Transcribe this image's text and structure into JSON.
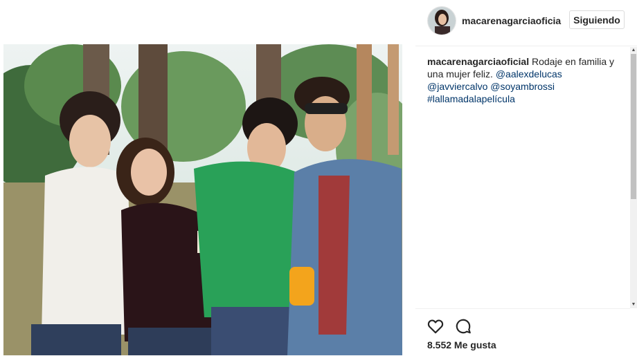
{
  "post": {
    "username": "macarenagarciaoficia",
    "follow_label": "Siguiendo",
    "caption_user": "macarenagarciaoficial",
    "caption_text": " Rodaje en familia y una mujer feliz. ",
    "mentions": [
      "@aalexdelucas",
      "@javviercalvo",
      "@soyambrossi"
    ],
    "hashtag": "#lallamadalapelícula",
    "likes": "8.552 Me gusta"
  },
  "icons": {
    "like": "heart-outline-icon",
    "comment": "comment-bubble-icon"
  },
  "colors": {
    "link": "#003569",
    "text": "#262626",
    "border": "#efefef"
  }
}
